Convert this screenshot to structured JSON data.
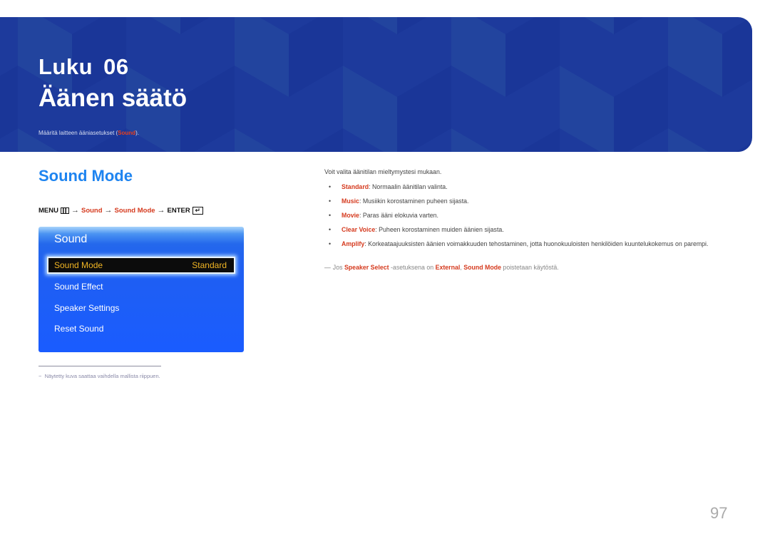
{
  "banner": {
    "chapter": "Luku  06",
    "title": "Äänen säätö",
    "subtitle_prefix": "Määritä laitteen ääniasetukset (",
    "subtitle_highlight": "Sound",
    "subtitle_suffix": ").",
    "color": "#1d3a9c"
  },
  "section": {
    "title": "Sound Mode"
  },
  "menu_path": {
    "menu_label": "MENU",
    "menu_icon": "menu-grid-icon",
    "arrow": "→",
    "step1": "Sound",
    "step2": "Sound Mode",
    "enter_label": "ENTER",
    "enter_icon": "enter-icon"
  },
  "osd_panel": {
    "title": "Sound",
    "selected_item": {
      "label": "Sound Mode",
      "value": "Standard"
    },
    "items": [
      "Sound Effect",
      "Speaker Settings",
      "Reset Sound"
    ]
  },
  "footnote": {
    "dash": "−",
    "text": "Näytetty kuva saattaa vaihdella mallista riippuen."
  },
  "description": {
    "intro": "Voit valita äänitilan mieltymystesi mukaan.",
    "bullets": [
      {
        "term": "Standard",
        "text": ": Normaalin äänitilan valinta."
      },
      {
        "term": "Music",
        "text": ": Musiikin korostaminen puheen sijasta."
      },
      {
        "term": "Movie",
        "text": ": Paras ääni elokuvia varten."
      },
      {
        "term": "Clear Voice",
        "text": ": Puheen korostaminen muiden äänien sijasta."
      },
      {
        "term": "Amplify",
        "text": ": Korkeataajuuksisten äänien voimakkuuden tehostaminen, jotta huonokuuloisten henkilöiden kuuntelukokemus on parempi."
      }
    ],
    "note": {
      "dash": "―",
      "part1": "Jos ",
      "term1": "Speaker Select",
      "part2": " -asetuksena on ",
      "term2": "External",
      "part3": ", ",
      "term3": "Sound Mode",
      "part4": " poistetaan käytöstä."
    }
  },
  "page_number": "97",
  "colors": {
    "accent_red": "#d53a1e",
    "heading_blue": "#1e84f0",
    "selected_text": "#f2b624"
  }
}
